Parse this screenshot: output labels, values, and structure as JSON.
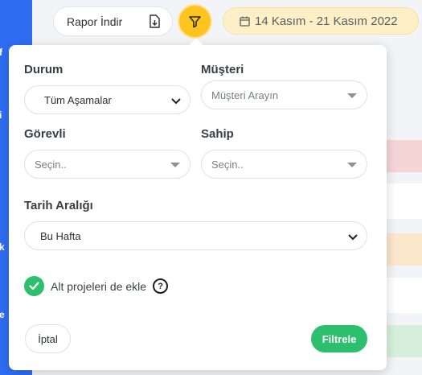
{
  "toolbar": {
    "report_label": "Rapor İndir",
    "date_range": "14 Kasım - 21 Kasım 2022"
  },
  "sidebar_fragments": [
    "f",
    "i",
    "k",
    "e"
  ],
  "filter_panel": {
    "durum": {
      "label": "Durum",
      "value": "Tüm Aşamalar"
    },
    "musteri": {
      "label": "Müşteri",
      "placeholder": "Müşteri Arayın"
    },
    "gorevli": {
      "label": "Görevli",
      "placeholder": "Seçin.."
    },
    "sahip": {
      "label": "Sahip",
      "placeholder": "Seçin.."
    },
    "tarih": {
      "label": "Tarih Aralığı",
      "value": "Bu Hafta"
    },
    "subprojects": {
      "label": "Alt projeleri de ekle",
      "checked": true,
      "help": "?"
    },
    "cancel_label": "İptal",
    "apply_label": "Filtrele"
  },
  "colors": {
    "accent_yellow": "#ffc41f",
    "accent_green": "#2bbf6e",
    "sidebar_blue": "#2f6df2"
  },
  "icons": [
    "download-file-icon",
    "filter-funnel-icon",
    "calendar-icon",
    "chevron-down-icon",
    "caret-down-icon",
    "checkmark-icon",
    "help-icon"
  ]
}
